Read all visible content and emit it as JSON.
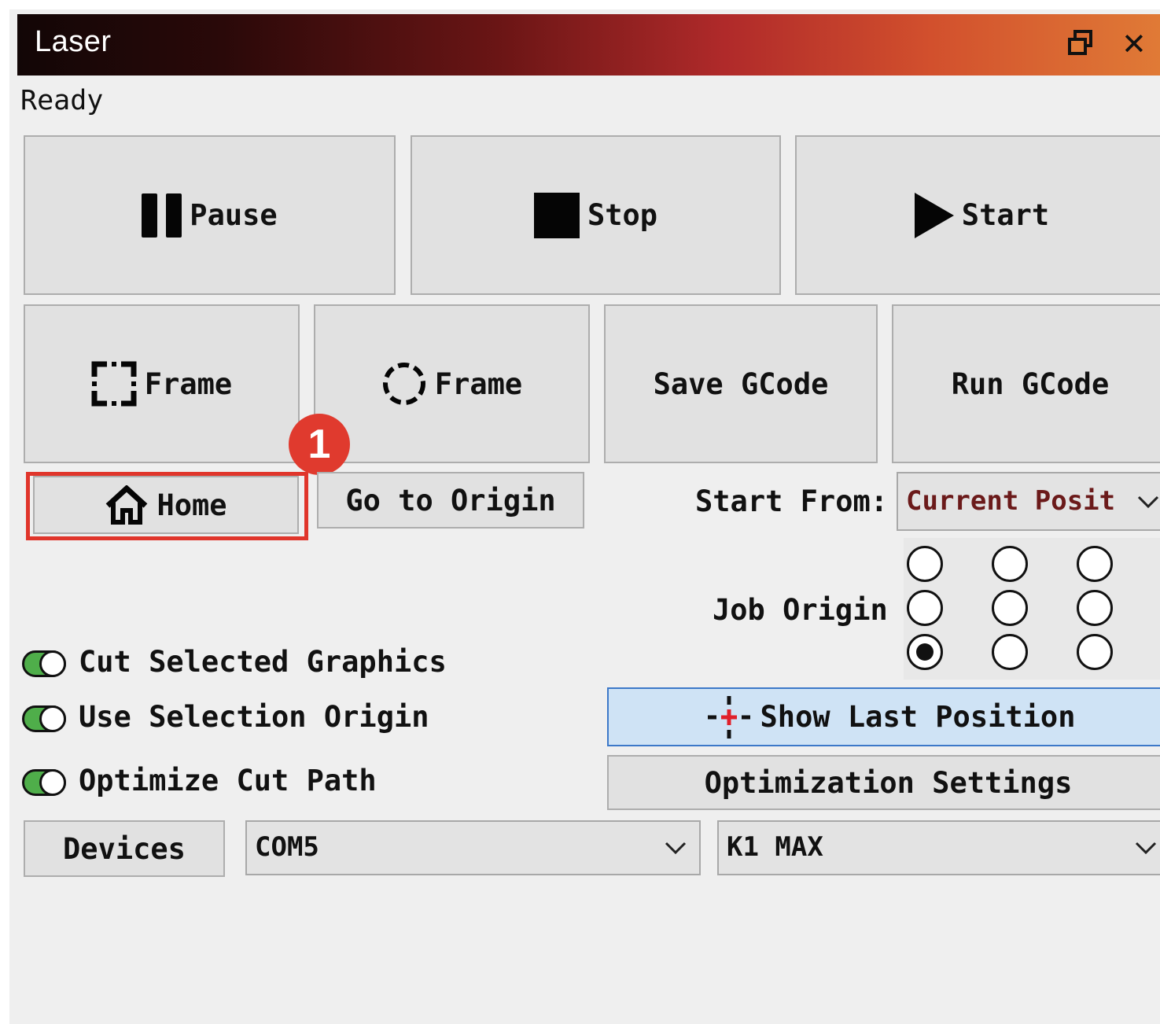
{
  "window": {
    "title": "Laser",
    "restore_glyph": "restore-window-icon",
    "close_glyph": "✕"
  },
  "status": "Ready",
  "controls": {
    "pause_label": "Pause",
    "stop_label": "Stop",
    "start_label": "Start",
    "frame_rect_label": "Frame",
    "frame_circle_label": "Frame",
    "save_gcode_label": "Save GCode",
    "run_gcode_label": "Run GCode",
    "home_label": "Home",
    "go_to_origin_label": "Go to Origin"
  },
  "annotation": {
    "badge_number": "1",
    "badge_color": "#e03a2e",
    "highlight_color": "#e0352b"
  },
  "start_from": {
    "label": "Start From:",
    "selected": "Current Posit"
  },
  "job_origin": {
    "label": "Job Origin",
    "rows": 3,
    "cols": 3,
    "selected_row": 2,
    "selected_col": 0
  },
  "options": {
    "cut_selected_graphics": {
      "label": "Cut Selected Graphics",
      "enabled": true
    },
    "use_selection_origin": {
      "label": "Use Selection Origin",
      "enabled": true
    },
    "optimize_cut_path": {
      "label": "Optimize Cut Path",
      "enabled": true
    }
  },
  "show_last_position_label": "Show Last Position",
  "optimization_settings_label": "Optimization Settings",
  "devices": {
    "button_label": "Devices",
    "port": "COM5",
    "device": "K1 MAX"
  },
  "colors": {
    "toggle_on": "#4fae4a",
    "crosshair_red": "#e0202a",
    "show_last_bg": "#cfe3f5",
    "show_last_border": "#3c78c8"
  }
}
